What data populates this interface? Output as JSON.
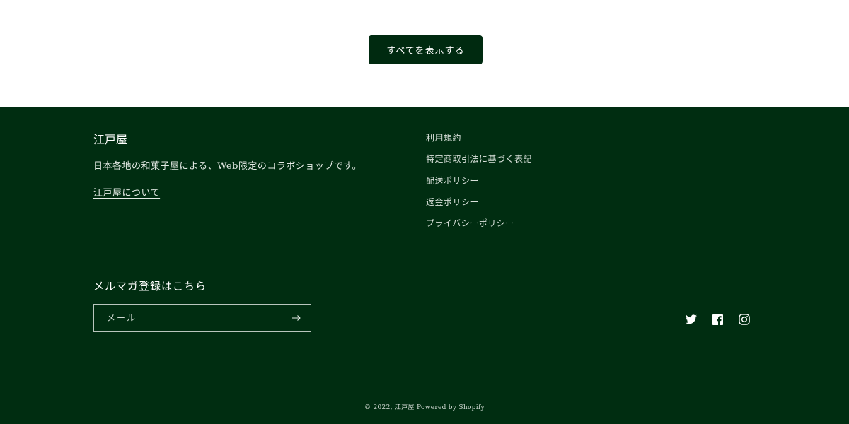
{
  "collection": {
    "view_all_label": "すべてを表示する"
  },
  "footer": {
    "brand": "江戸屋",
    "description": "日本各地の和菓子屋による、Web限定のコラボショップです。",
    "about_link": "江戸屋について",
    "links": [
      "利用規約",
      "特定商取引法に基づく表記",
      "配送ポリシー",
      "返金ポリシー",
      "プライバシーポリシー"
    ],
    "newsletter": {
      "title": "メルマガ登録はこちら",
      "placeholder": "メール",
      "submit_icon": "arrow-right-icon"
    },
    "social": [
      "twitter-icon",
      "facebook-icon",
      "instagram-icon"
    ],
    "copyright_prefix": "© 2022, ",
    "copyright_shop": "江戸屋",
    "powered_by": " Powered by Shopify"
  },
  "colors": {
    "footer_bg": "#002d11",
    "button_bg": "#002a10",
    "text_light": "#e6ece7"
  }
}
